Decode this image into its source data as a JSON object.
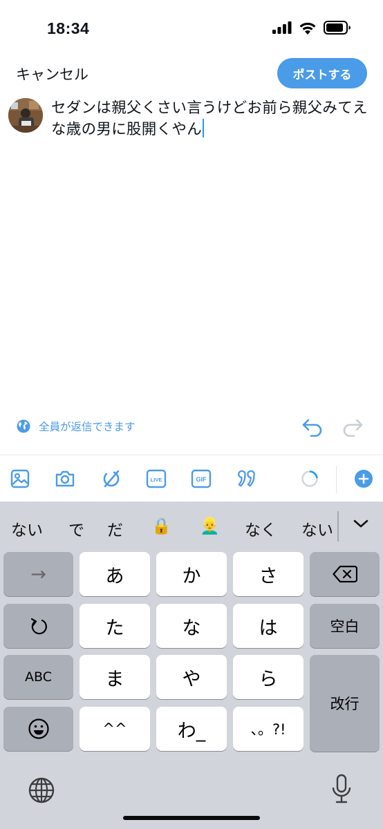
{
  "status_bar": {
    "time": "18:34",
    "battery_icon": "battery-icon",
    "wifi_icon": "wifi-icon",
    "signal_icon": "signal-icon"
  },
  "header": {
    "cancel_label": "キャンセル",
    "post_label": "ポストする"
  },
  "composer": {
    "text": "セダンは親父くさい言うけどお前ら親父みてえな歳の男に股開くやん",
    "avatar_icon": "avatar"
  },
  "reply_setting": {
    "label": "全員が返信できます",
    "icon": "globe-icon"
  },
  "toolbar": {
    "icons": [
      "image-icon",
      "camera-icon",
      "grok-icon",
      "live-icon",
      "gif-icon",
      "quote-icon",
      "progress-ring-icon",
      "add-post-icon"
    ],
    "live_label": "LIVE",
    "gif_label": "GIF"
  },
  "candidates": [
    "ない",
    "で",
    "だ",
    "🔒",
    "👱‍♂️",
    "なく",
    "ない"
  ],
  "keys": {
    "arrow": "→",
    "a": "あ",
    "ka": "か",
    "sa": "さ",
    "ta": "た",
    "na": "な",
    "ha": "は",
    "ma": "ま",
    "ya": "や",
    "ra": "ら",
    "dakuten": "^^",
    "wa": "わ_",
    "punct": "、。?!",
    "space": "空白",
    "enter": "改行",
    "abc": "ABC"
  },
  "colors": {
    "accent": "#4a9be8",
    "keyboard_bg": "#d1d4da",
    "key_dark": "#abafb8"
  }
}
